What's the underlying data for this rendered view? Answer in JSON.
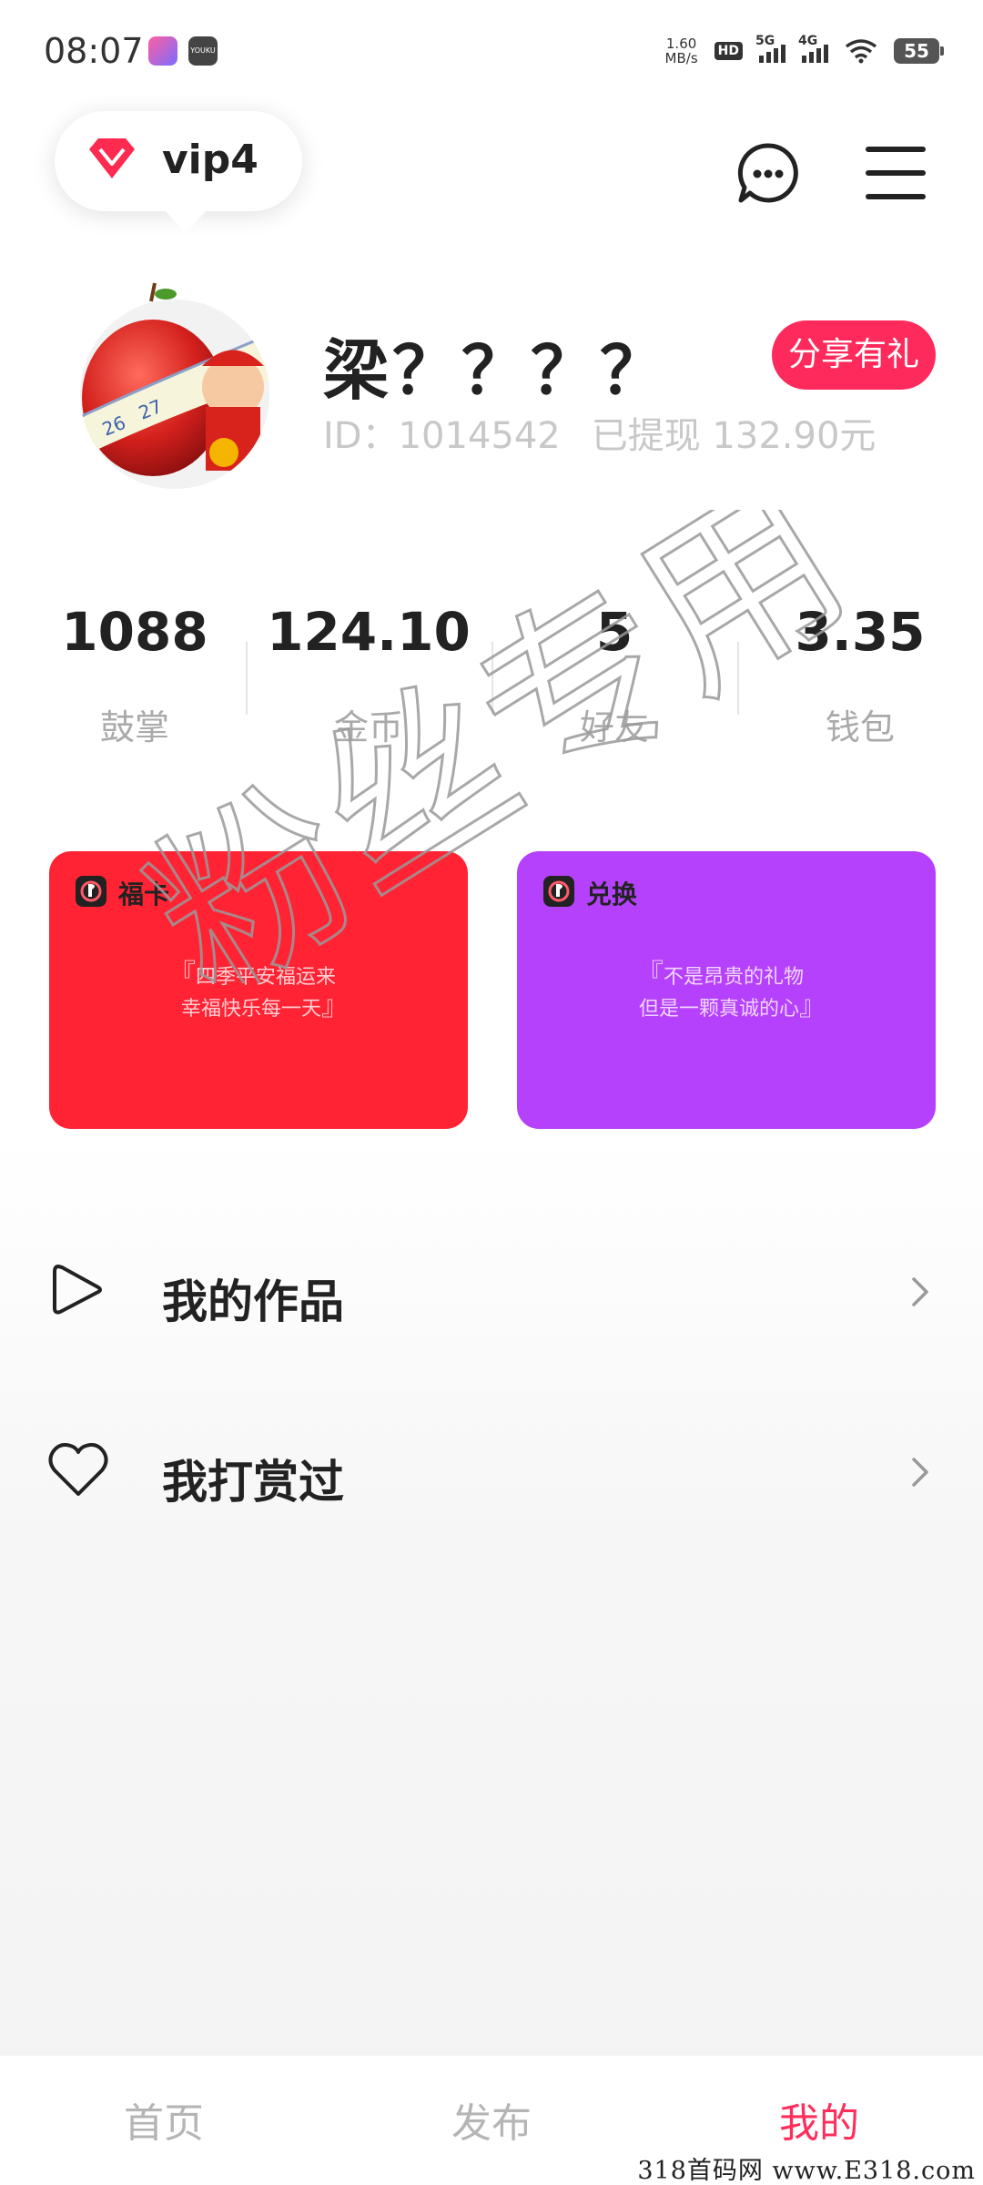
{
  "status_bar": {
    "time": "08:07",
    "net_speed": "1.60",
    "net_unit": "MB/s",
    "hd": "HD",
    "sim1": "5G",
    "sim2": "4G",
    "battery": "55",
    "app_icon_2_text": "YOUKU"
  },
  "header": {
    "vip_label": "vip4"
  },
  "profile": {
    "name": "梁？？？？",
    "id_text": "ID：1014542",
    "withdrawn_text": "已提现 132.90元",
    "share_label": "分享有礼"
  },
  "stats": [
    {
      "value": "1088",
      "label": "鼓掌"
    },
    {
      "value": "124.10",
      "label": "金币"
    },
    {
      "value": "5",
      "label": "好友"
    },
    {
      "value": "3.35",
      "label": "钱包"
    }
  ],
  "cards": [
    {
      "title": "福卡",
      "line1": "四季平安福运来",
      "line2": "幸福快乐每一天",
      "color": "#ff2334"
    },
    {
      "title": "兑换",
      "line1": "不是昂贵的礼物",
      "line2": "但是一颗真诚的心",
      "color": "#b641fc"
    }
  ],
  "menu": [
    {
      "label": "我的作品",
      "icon": "play-icon"
    },
    {
      "label": "我打赏过",
      "icon": "heart-icon"
    }
  ],
  "tabs": [
    {
      "label": "首页",
      "active": false
    },
    {
      "label": "发布",
      "active": false
    },
    {
      "label": "我的",
      "active": true
    }
  ],
  "watermark_text": "粉丝专用",
  "footer_watermark": "318首码网 www.E318.com",
  "colors": {
    "accent": "#ff2a5c",
    "card_red": "#ff2334",
    "card_purple": "#b641fc"
  }
}
